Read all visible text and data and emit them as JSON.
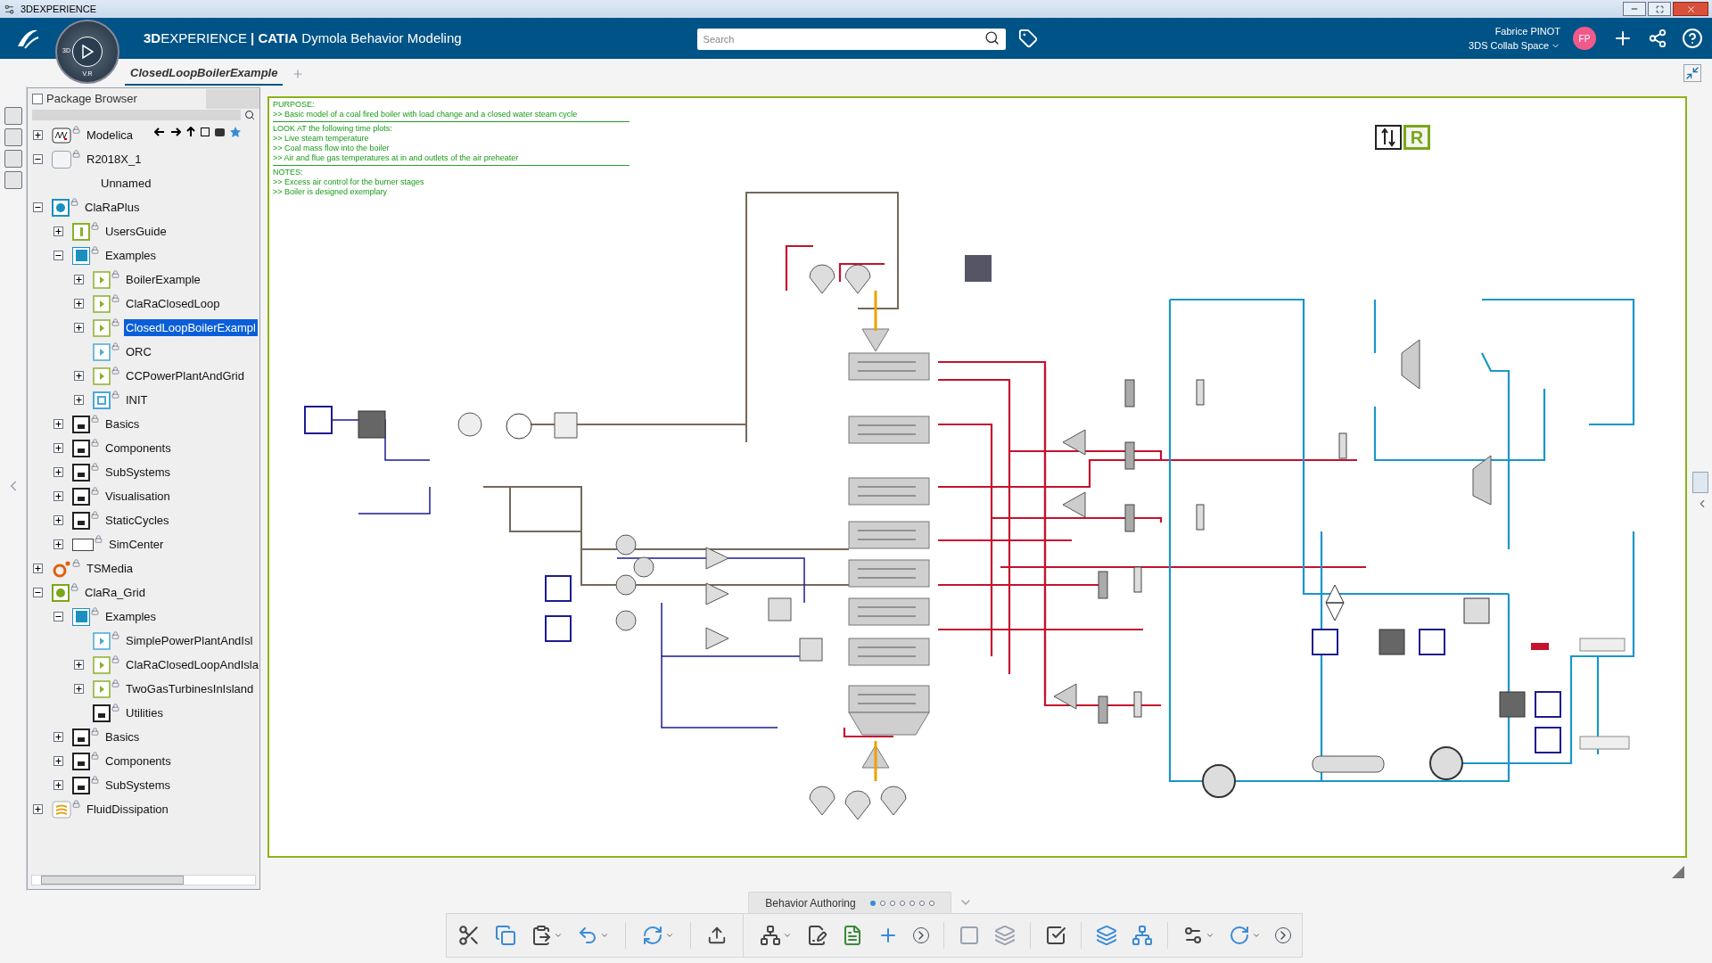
{
  "window": {
    "title": "3DEXPERIENCE"
  },
  "header": {
    "brand_bold": "3D",
    "brand_rest": "EXPERIENCE",
    "app_prefix": "| CATIA",
    "app_name": "Dymola Behavior Modeling",
    "compass_labels": [
      "3D",
      "V.R"
    ],
    "search": {
      "placeholder": "Search"
    },
    "user": {
      "name": "Fabrice PINOT",
      "initials": "FP",
      "space": "3DS Collab Space"
    }
  },
  "tabs": [
    {
      "label": "ClosedLoopBoilerExample",
      "selected": true
    }
  ],
  "package_browser": {
    "title": "Package Browser",
    "tree": [
      {
        "name": "Modelica",
        "kind": "modelica",
        "expanded": false
      },
      {
        "name": "R2018X_1",
        "kind": "blank",
        "expanded": true,
        "children": [
          {
            "name": "Unnamed",
            "kind": "none"
          }
        ]
      },
      {
        "name": "ClaRaPlus",
        "kind": "library",
        "expanded": true,
        "children": [
          {
            "name": "UsersGuide",
            "kind": "info",
            "expanded": false
          },
          {
            "name": "Examples",
            "kind": "examples",
            "expanded": true,
            "children": [
              {
                "name": "BoilerExample",
                "kind": "example",
                "expanded": false
              },
              {
                "name": "ClaRaClosedLoop",
                "kind": "example",
                "expanded": false
              },
              {
                "name": "ClosedLoopBoilerExampl",
                "kind": "example",
                "expanded": false,
                "selected": true
              },
              {
                "name": "ORC",
                "kind": "example-blue",
                "selected": false
              },
              {
                "name": "CCPowerPlantAndGrid",
                "kind": "example",
                "expanded": false
              },
              {
                "name": "INIT",
                "kind": "init",
                "expanded": false
              }
            ]
          },
          {
            "name": "Basics",
            "kind": "package",
            "expanded": false
          },
          {
            "name": "Components",
            "kind": "package",
            "expanded": false
          },
          {
            "name": "SubSystems",
            "kind": "package",
            "expanded": false
          },
          {
            "name": "Visualisation",
            "kind": "package",
            "expanded": false
          },
          {
            "name": "StaticCycles",
            "kind": "package",
            "expanded": false
          },
          {
            "name": "SimCenter",
            "kind": "simcenter",
            "expanded": false
          }
        ]
      },
      {
        "name": "TSMedia",
        "kind": "tsmedia",
        "expanded": false
      },
      {
        "name": "ClaRa_Grid",
        "kind": "library-green",
        "expanded": true,
        "children": [
          {
            "name": "Examples",
            "kind": "examples",
            "expanded": true,
            "children": [
              {
                "name": "SimplePowerPlantAndIsl",
                "kind": "example-blue",
                "selected": false
              },
              {
                "name": "ClaRaClosedLoopAndIsla",
                "kind": "example",
                "expanded": false
              },
              {
                "name": "TwoGasTurbinesInIsland",
                "kind": "example",
                "expanded": false
              },
              {
                "name": "Utilities",
                "kind": "package"
              }
            ]
          },
          {
            "name": "Basics",
            "kind": "package",
            "expanded": false
          },
          {
            "name": "Components",
            "kind": "package",
            "expanded": false
          },
          {
            "name": "SubSystems",
            "kind": "package",
            "expanded": false
          }
        ]
      },
      {
        "name": "FluidDissipation",
        "kind": "fluid",
        "expanded": false
      }
    ]
  },
  "diagram": {
    "notes": [
      {
        "kind": "heading",
        "text": "PURPOSE:"
      },
      {
        "kind": "line",
        "text": ">> Basic model of a coal fired boiler with load change and a closed water steam cycle"
      },
      {
        "kind": "rule"
      },
      {
        "kind": "heading",
        "text": "LOOK AT the following time plots:"
      },
      {
        "kind": "line",
        "text": ">> Live steam temperature"
      },
      {
        "kind": "line",
        "text": ">> Coal mass flow into the boiler"
      },
      {
        "kind": "line",
        "text": ">> Air and flue gas temperatures at in and outlets of the air preheater"
      },
      {
        "kind": "rule"
      },
      {
        "kind": "heading",
        "text": "NOTES:"
      },
      {
        "kind": "line",
        "text": ">> Excess air control for the burner stages"
      },
      {
        "kind": "line",
        "text": ">> Boiler is designed exemplary"
      }
    ],
    "badge": "R"
  },
  "bottom": {
    "section_tab": "Behavior Authoring",
    "page_dots": [
      {
        "selected": true
      },
      {
        "selected": false
      },
      {
        "selected": false
      },
      {
        "selected": false
      },
      {
        "selected": false
      },
      {
        "selected": false
      },
      {
        "selected": false
      }
    ]
  }
}
